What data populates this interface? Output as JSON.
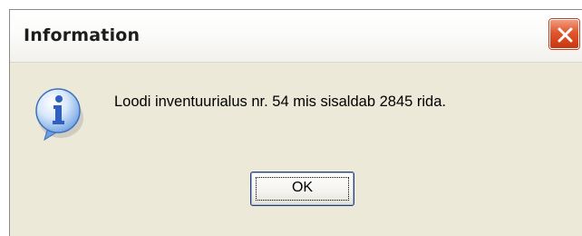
{
  "window": {
    "title": "Information",
    "close_icon": "close-icon"
  },
  "dialog": {
    "icon": "info-icon",
    "message": "Loodi inventuurialus nr. 54 mis sisaldab 2845 rida.",
    "ok_label": "OK"
  },
  "colors": {
    "dialog_background": "#ece9d8",
    "close_button": "#e0562e",
    "info_icon": "#2f73d4"
  }
}
